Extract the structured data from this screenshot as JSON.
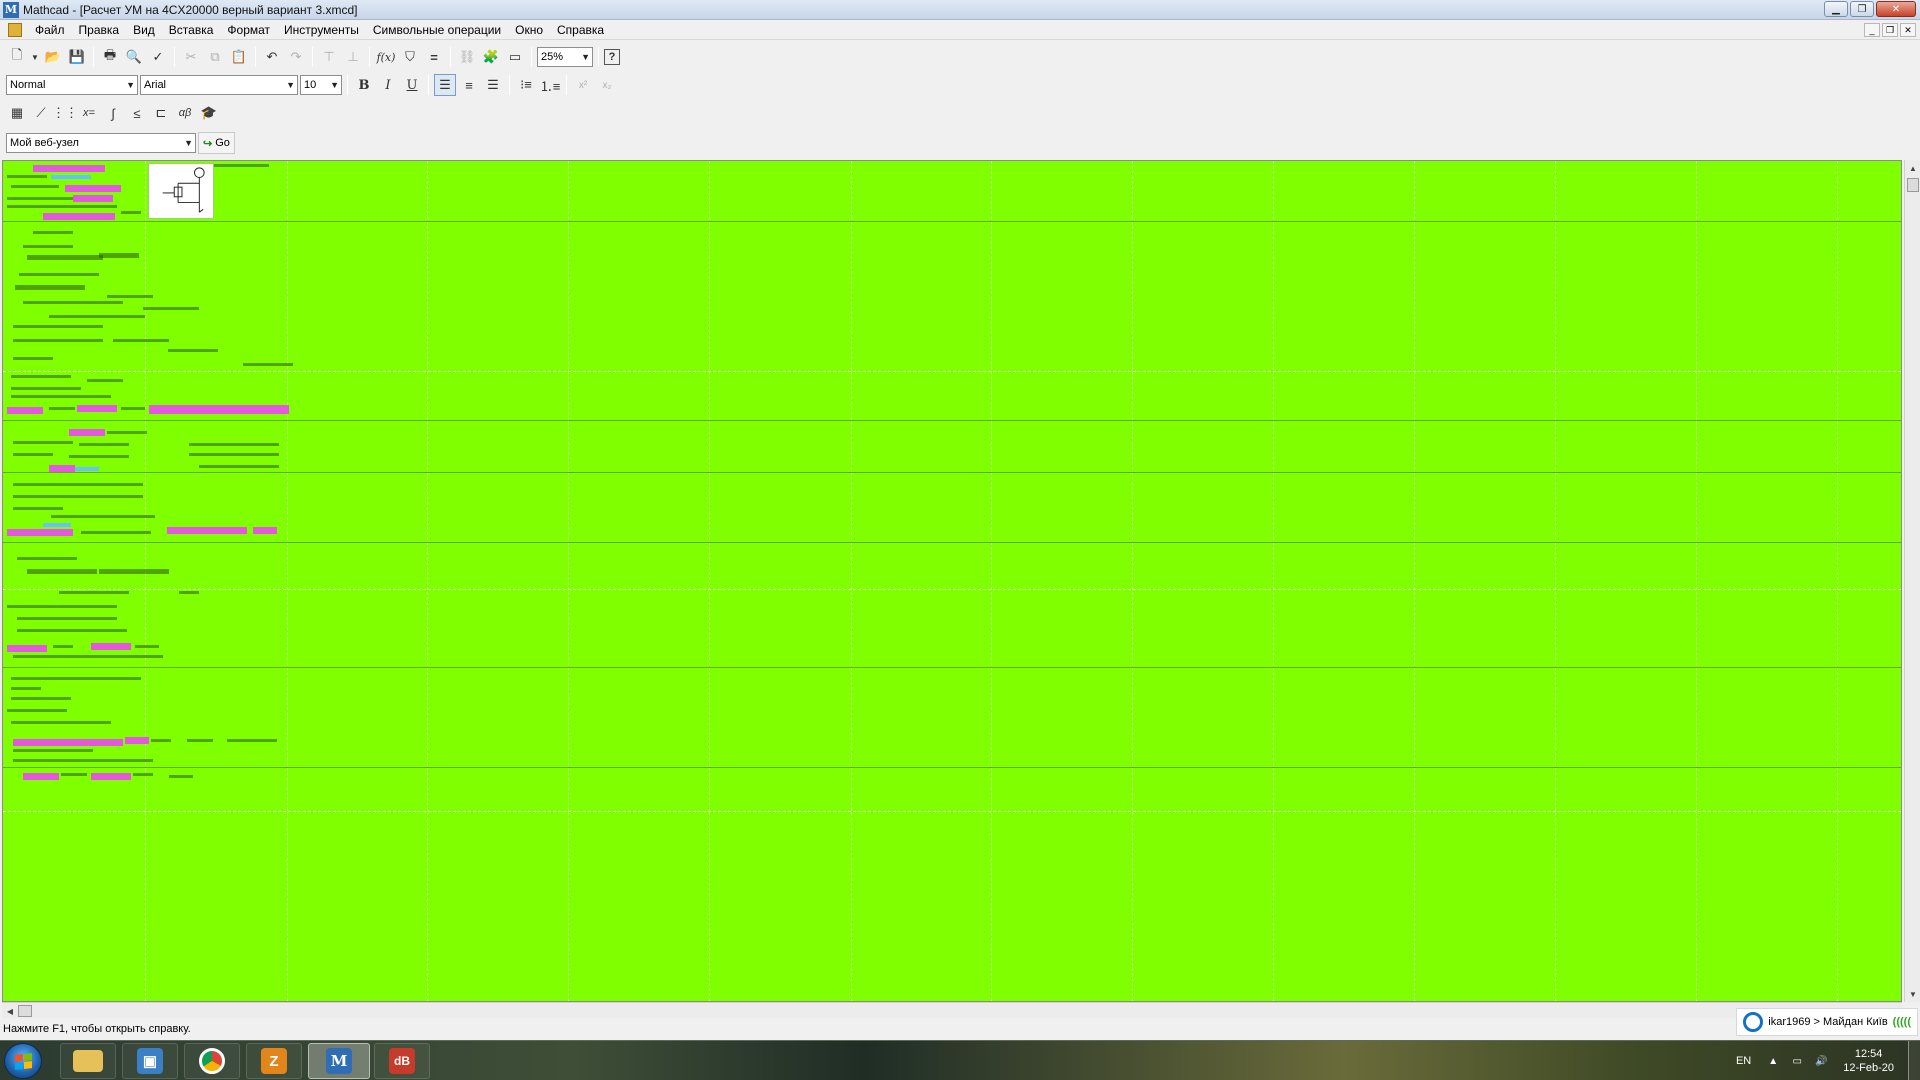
{
  "window": {
    "title": "Mathcad - [Расчет УМ на 4CX20000  верный вариант 3.xmcd]",
    "app_icon": "mathcad-icon"
  },
  "menu": {
    "items": [
      "Файл",
      "Правка",
      "Вид",
      "Вставка",
      "Формат",
      "Инструменты",
      "Символьные операции",
      "Окно",
      "Справка"
    ]
  },
  "toolbar_standard": {
    "zoom": "25%",
    "help_glyph": "?"
  },
  "toolbar_format": {
    "style": "Normal",
    "font": "Arial",
    "size": "10",
    "bold": "B",
    "italic": "I",
    "underline": "U"
  },
  "toolbar_math": {
    "eq_label": "x=",
    "greek_label": "αβ"
  },
  "toolbar_web": {
    "site": "Мой веб-узел",
    "go": "Go"
  },
  "worksheet": {
    "background": "#80ff00",
    "highlight_color": "#e458e0"
  },
  "status": {
    "text": "Нажмите F1, чтобы открыть справку."
  },
  "notification": {
    "text": "ikar1969 > Майдан Київ",
    "bars": "((((("
  },
  "taskbar": {
    "apps": [
      {
        "name": "explorer",
        "icon": "folder-icon"
      },
      {
        "name": "network",
        "icon": "network-icon"
      },
      {
        "name": "chrome",
        "icon": "chrome-icon"
      },
      {
        "name": "filezilla",
        "icon": "filezilla-icon",
        "label": "Z"
      },
      {
        "name": "mathcad",
        "icon": "mathcad-icon",
        "label": "M"
      },
      {
        "name": "foxit",
        "icon": "reader-icon",
        "label": "dB"
      }
    ],
    "lang": "EN",
    "time": "12:54",
    "date": "12-Feb-20"
  }
}
